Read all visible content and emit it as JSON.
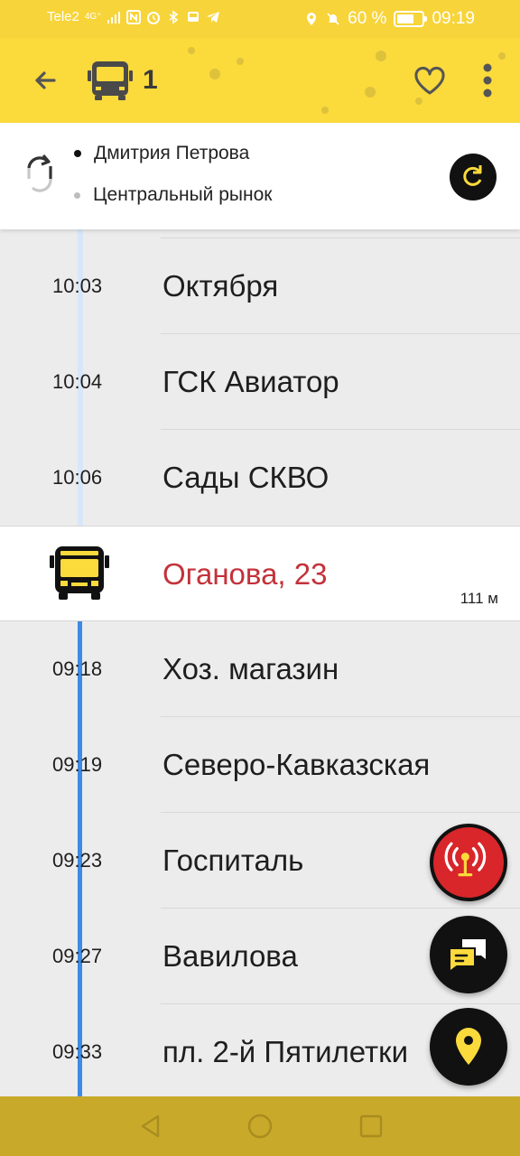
{
  "status_bar": {
    "carrier": "Tele2",
    "network": "4G⁺",
    "battery": "60 %",
    "time": "09:19"
  },
  "app_bar": {
    "route_number": "1",
    "icons": [
      "back-arrow-icon",
      "bus-icon",
      "heart-icon",
      "more-vert-icon"
    ]
  },
  "direction": {
    "from": "Дмитрия Петрова",
    "to": "Центральный рынок",
    "icons": [
      "swap-direction-icon",
      "refresh-icon"
    ]
  },
  "stops": [
    {
      "time": "",
      "name": "",
      "state": "past"
    },
    {
      "time": "10:03",
      "name": "Октября",
      "state": "past"
    },
    {
      "time": "10:04",
      "name": "ГСК Авиатор",
      "state": "past"
    },
    {
      "time": "10:06",
      "name": "Сады СКВО",
      "state": "past"
    },
    {
      "time": "",
      "name": "Оганова, 23",
      "state": "current",
      "distance": "111 м"
    },
    {
      "time": "09:18",
      "name": "Хоз. магазин",
      "state": "upcoming"
    },
    {
      "time": "09:19",
      "name": "Северо-Кавказская",
      "state": "upcoming"
    },
    {
      "time": "09:23",
      "name": "Госпиталь",
      "state": "upcoming"
    },
    {
      "time": "09:27",
      "name": "Вавилова",
      "state": "upcoming"
    },
    {
      "time": "09:33",
      "name": "пл. 2-й Пятилетки",
      "state": "upcoming"
    }
  ],
  "fabs": [
    "live-signal-icon",
    "chat-icon",
    "location-pin-icon"
  ],
  "colors": {
    "accent_yellow": "#fbda3c",
    "current_stop_red": "#c3323a",
    "timeline_blue": "#3d8be3",
    "live_fab_red": "#d9262a"
  }
}
